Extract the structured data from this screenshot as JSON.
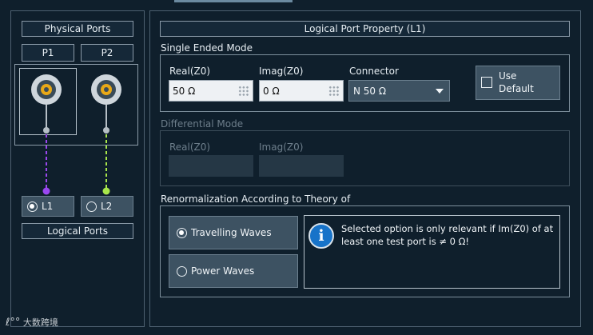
{
  "physical_ports": {
    "title": "Physical Ports",
    "ports": [
      "P1",
      "P2"
    ]
  },
  "logical_ports": {
    "title": "Logical Ports",
    "items": [
      {
        "label": "L1",
        "selected": true,
        "line_color": "#9b47f0"
      },
      {
        "label": "L2",
        "selected": false,
        "line_color": "#a8e64a"
      }
    ]
  },
  "property": {
    "title": "Logical Port Property (L1)",
    "single_ended": {
      "title": "Single Ended Mode",
      "real_label": "Real(Z0)",
      "real_value": "50 Ω",
      "imag_label": "Imag(Z0)",
      "imag_value": "0 Ω",
      "connector_label": "Connector",
      "connector_value": "N 50 Ω",
      "use_default_line1": "Use",
      "use_default_line2": "Default"
    },
    "differential": {
      "title": "Differential Mode",
      "real_label": "Real(Z0)",
      "imag_label": "Imag(Z0)"
    },
    "renorm": {
      "title": "Renormalization According to Theory of",
      "options": [
        {
          "label": "Travelling Waves",
          "selected": true
        },
        {
          "label": "Power Waves",
          "selected": false
        }
      ],
      "info_text": "Selected option is only relevant if Im(Z0) of at least one test port is ≠ 0 Ω!"
    }
  },
  "watermark": "大数跨境"
}
